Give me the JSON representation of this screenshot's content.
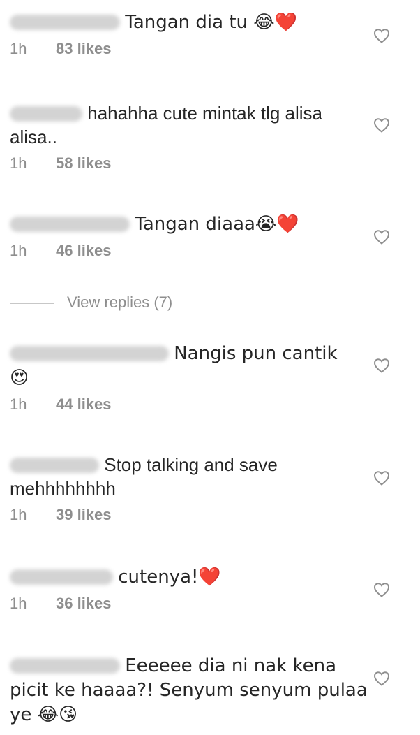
{
  "comments": [
    {
      "text": "Tangan dia tu 😂❤️",
      "time": "1h",
      "likes": "83 likes"
    },
    {
      "text": "hahahha cute mintak tlg alisa\nalisa..",
      "time": "1h",
      "likes": "58 likes"
    },
    {
      "text": "Tangan diaaa😭❤️",
      "time": "1h",
      "likes": "46 likes"
    },
    {
      "text": "Nangis pun cantik\n😍",
      "time": "1h",
      "likes": "44 likes"
    },
    {
      "text": "Stop talking and save\nmehhhhhhhh",
      "time": "1h",
      "likes": "39 likes"
    },
    {
      "text": "cutenya!❤️",
      "time": "1h",
      "likes": "36 likes"
    },
    {
      "text": "Eeeeee dia ni nak kena\npicit ke haaaa?! Senyum senyum pulaa\nye 😂😘",
      "time": "",
      "likes": ""
    }
  ],
  "view_replies": "View replies (7)",
  "icons": {
    "like": "heart-outline-icon"
  },
  "colors": {
    "text": "#262626",
    "muted": "#8e8e8e"
  }
}
